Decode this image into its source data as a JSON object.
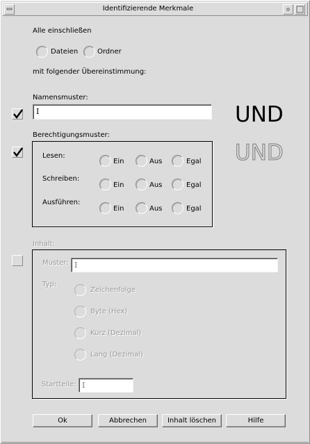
{
  "window": {
    "title": "Identifizierende Merkmale"
  },
  "include": {
    "label": "Alle einschließen",
    "files_label": "Dateien",
    "folders_label": "Ordner"
  },
  "match_label": "mit folgender Übereinstimmung:",
  "name_pattern": {
    "checked": true,
    "label": "Namensmuster:",
    "value": "",
    "and_label": "UND"
  },
  "permission": {
    "checked": true,
    "label": "Berechtigungsmuster:",
    "and_label": "UND",
    "rows": [
      {
        "label": "Lesen:",
        "on": "Ein",
        "off": "Aus",
        "any": "Egal"
      },
      {
        "label": "Schreiben:",
        "on": "Ein",
        "off": "Aus",
        "any": "Egal"
      },
      {
        "label": "Ausführen:",
        "on": "Ein",
        "off": "Aus",
        "any": "Egal"
      }
    ]
  },
  "content": {
    "checked": false,
    "label": "Inhalt:",
    "pattern_label": "Muster:",
    "pattern_value": "",
    "type_label": "Typ:",
    "types": [
      "Zeichenfolge",
      "Byte (Hex)",
      "Kurz (Dezimal)",
      "Lang (Dezimal)"
    ],
    "offset_label": "Startteile:",
    "offset_value": ""
  },
  "buttons": {
    "ok": "Ok",
    "cancel": "Abbrechen",
    "clear": "Inhalt löschen",
    "help": "Hilfe"
  },
  "colors": {
    "background": "#dcdcdc",
    "disabled_text": "#9a9a9a"
  },
  "icons": {
    "window_menu": "window-menu-icon",
    "minimize": "minimize-icon",
    "maximize": "maximize-icon",
    "checkmark": "checkmark-icon"
  }
}
